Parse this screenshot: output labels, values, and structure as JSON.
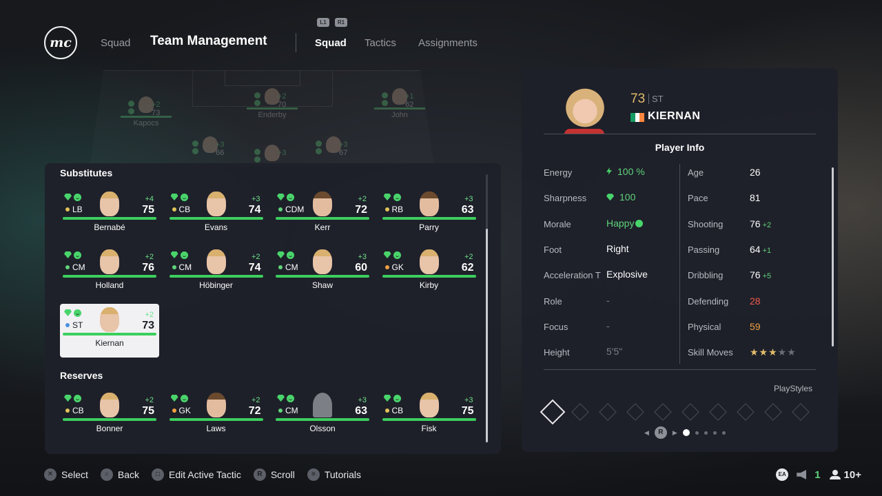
{
  "header": {
    "logo": "mc",
    "squad_label": "Squad",
    "title": "Team Management",
    "hint_l1": "L1",
    "hint_r1": "R1",
    "tabs": [
      {
        "label": "Squad",
        "active": true
      },
      {
        "label": "Tactics",
        "active": false
      },
      {
        "label": "Assignments",
        "active": false
      }
    ]
  },
  "pitch_players": [
    {
      "name": "Kapocs",
      "rating": "73",
      "boost": "+2"
    },
    {
      "name": "Enderby",
      "rating": "70",
      "boost": "+2"
    },
    {
      "name": "John",
      "rating": "62",
      "boost": "+1"
    },
    {
      "name": "",
      "rating": "66",
      "boost": "+3"
    },
    {
      "name": "",
      "rating": "",
      "boost": "+3"
    },
    {
      "name": "",
      "rating": "67",
      "boost": "+3"
    }
  ],
  "substitutes": {
    "heading": "Substitutes",
    "players": [
      {
        "name": "Bernabé",
        "pos": "LB",
        "rating": "75",
        "boost": "+4",
        "pos_color": "#e2c35a"
      },
      {
        "name": "Evans",
        "pos": "CB",
        "rating": "74",
        "boost": "+3",
        "pos_color": "#e2c35a"
      },
      {
        "name": "Kerr",
        "pos": "CDM",
        "rating": "72",
        "boost": "+2",
        "pos_color": "#5fd37a"
      },
      {
        "name": "Parry",
        "pos": "RB",
        "rating": "63",
        "boost": "+3",
        "pos_color": "#e2c35a"
      },
      {
        "name": "Holland",
        "pos": "CM",
        "rating": "76",
        "boost": "+2",
        "pos_color": "#5fd37a"
      },
      {
        "name": "Höbinger",
        "pos": "CM",
        "rating": "74",
        "boost": "+2",
        "pos_color": "#5fd37a"
      },
      {
        "name": "Shaw",
        "pos": "CM",
        "rating": "60",
        "boost": "+3",
        "pos_color": "#5fd37a"
      },
      {
        "name": "Kirby",
        "pos": "GK",
        "rating": "62",
        "boost": "+2",
        "pos_color": "#f0a040"
      },
      {
        "name": "Kiernan",
        "pos": "ST",
        "rating": "73",
        "boost": "+2",
        "pos_color": "#4a90e2",
        "selected": true
      }
    ]
  },
  "reserves": {
    "heading": "Reserves",
    "players": [
      {
        "name": "Bonner",
        "pos": "CB",
        "rating": "75",
        "boost": "+2",
        "pos_color": "#e2c35a"
      },
      {
        "name": "Laws",
        "pos": "GK",
        "rating": "72",
        "boost": "+2",
        "pos_color": "#f0a040"
      },
      {
        "name": "Olsson",
        "pos": "CM",
        "rating": "63",
        "boost": "+3",
        "pos_color": "#5fd37a"
      },
      {
        "name": "Fisk",
        "pos": "CB",
        "rating": "75",
        "boost": "+3",
        "pos_color": "#e2c35a"
      }
    ]
  },
  "player_info": {
    "overall": "73",
    "position": "ST",
    "name": "KIERNAN",
    "flag_colors": [
      "#169b62",
      "#ffffff",
      "#ff883e"
    ],
    "title": "Player Info",
    "left": [
      {
        "label": "Energy",
        "value": "100 %"
      },
      {
        "label": "Sharpness",
        "value": "100"
      },
      {
        "label": "Morale",
        "value": "Happy"
      },
      {
        "label": "Foot",
        "value": "Right"
      },
      {
        "label": "Acceleration T",
        "value": "Explosive"
      },
      {
        "label": "Role",
        "value": "-"
      },
      {
        "label": "Focus",
        "value": "-"
      },
      {
        "label": "Height",
        "value": "5'5\""
      }
    ],
    "right": [
      {
        "label": "Age",
        "value": "26",
        "boost": ""
      },
      {
        "label": "Pace",
        "value": "81",
        "boost": ""
      },
      {
        "label": "Shooting",
        "value": "76",
        "boost": "+2"
      },
      {
        "label": "Passing",
        "value": "64",
        "boost": "+1"
      },
      {
        "label": "Dribbling",
        "value": "76",
        "boost": "+5"
      },
      {
        "label": "Defending",
        "value": "28",
        "boost": ""
      },
      {
        "label": "Physical",
        "value": "59",
        "boost": ""
      },
      {
        "label": "Skill Moves",
        "value": "",
        "boost": ""
      }
    ],
    "skill_moves_stars": 3,
    "playstyles_label": "PlayStyles",
    "pager_button": "R"
  },
  "footer": {
    "hints": [
      {
        "glyph": "✕",
        "label": "Select"
      },
      {
        "glyph": "○",
        "label": "Back"
      },
      {
        "glyph": "□",
        "label": "Edit Active Tactic"
      },
      {
        "glyph": "R",
        "label": "Scroll"
      },
      {
        "glyph": "≡",
        "label": "Tutorials"
      }
    ],
    "ea": "EA",
    "online": "1",
    "party": "10+"
  }
}
